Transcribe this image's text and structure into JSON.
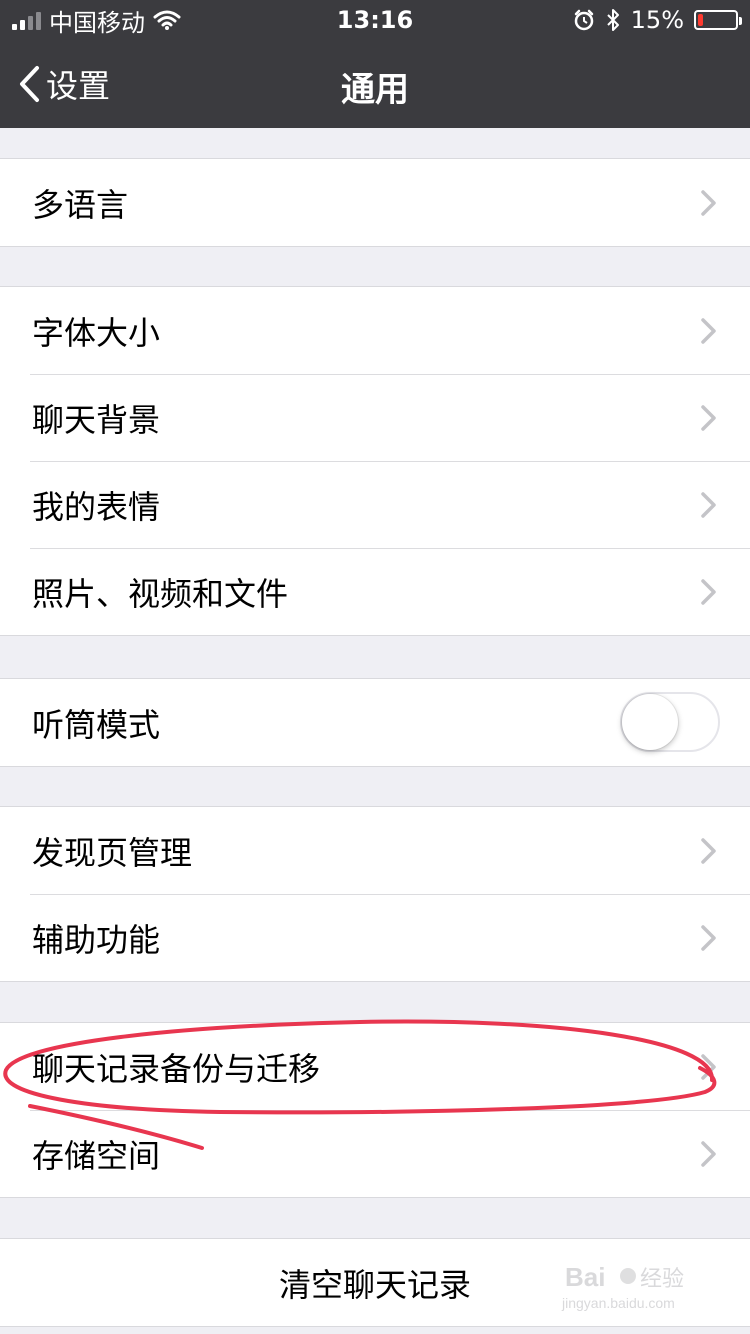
{
  "status_bar": {
    "carrier": "中国移动",
    "time": "13:16",
    "battery_percent_text": "15%",
    "battery_level": 0.15
  },
  "nav": {
    "back_label": "设置",
    "title": "通用"
  },
  "groups": [
    {
      "items": [
        {
          "label": "多语言"
        }
      ]
    },
    {
      "items": [
        {
          "label": "字体大小"
        },
        {
          "label": "聊天背景"
        },
        {
          "label": "我的表情"
        },
        {
          "label": "照片、视频和文件"
        }
      ]
    },
    {
      "items": [
        {
          "label": "听筒模式",
          "toggle_on": false
        }
      ]
    },
    {
      "items": [
        {
          "label": "发现页管理"
        },
        {
          "label": "辅助功能"
        }
      ]
    },
    {
      "items": [
        {
          "label": "聊天记录备份与迁移"
        },
        {
          "label": "存储空间"
        }
      ]
    },
    {
      "items": [
        {
          "label": "清空聊天记录"
        }
      ]
    }
  ],
  "colors": {
    "topbar_bg": "#3b3b3f",
    "page_bg": "#efeff4",
    "annotation_red": "#e8364f",
    "battery_red": "#ff3b30"
  },
  "icons": [
    "signal-icon",
    "wifi-icon",
    "alarm-icon",
    "bluetooth-icon",
    "battery-icon",
    "back-chevron-icon",
    "chevron-right-icon"
  ]
}
